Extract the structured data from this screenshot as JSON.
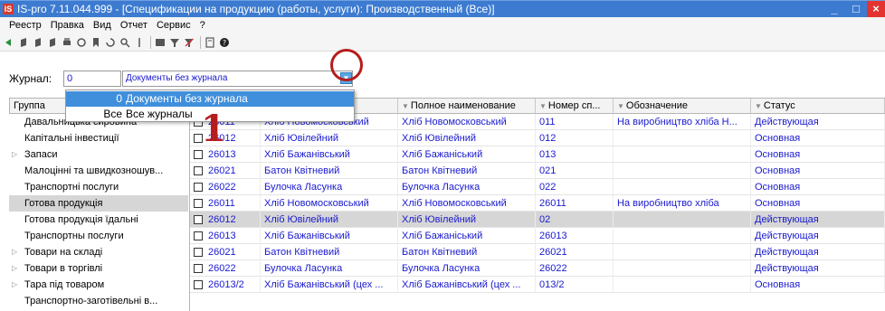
{
  "window": {
    "icon_label": "IS",
    "title": "IS-pro 7.11.044.999 - [Спецификации на продукцию (работы, услуги): Производственный (Все)]",
    "minimize": "_",
    "maximize": "□",
    "close": "×"
  },
  "menu": [
    "Реестр",
    "Правка",
    "Вид",
    "Отчет",
    "Сервис",
    "?"
  ],
  "toolbar_icons": [
    "new-icon",
    "copy-icon",
    "edit-icon",
    "delete-icon",
    "print-icon",
    "filter-icon",
    "refresh-icon",
    "find-icon",
    "bookmark-icon",
    "table-icon",
    "funnel-icon",
    "clear-filter-icon",
    "form-icon",
    "help-icon"
  ],
  "journal": {
    "label": "Журнал:",
    "code": "0",
    "name": "Документы без журнала",
    "dropdown_options": [
      {
        "code": "0",
        "name": "Документы без журнала"
      },
      {
        "code": "Все",
        "name": "Все журналы"
      }
    ]
  },
  "groups": {
    "header": "Группа",
    "items": [
      {
        "label": "Давальницька сировина",
        "expandable": false
      },
      {
        "label": "Капітальні інвестиції",
        "expandable": false
      },
      {
        "label": "Запаси",
        "expandable": true
      },
      {
        "label": "Малоцінні та швидкозношув...",
        "expandable": false
      },
      {
        "label": "Транспортні послуги",
        "expandable": false
      },
      {
        "label": "Готова продукція",
        "expandable": false
      },
      {
        "label": "Готова продукція їдальні",
        "expandable": false
      },
      {
        "label": "Транспортны послуги",
        "expandable": false
      },
      {
        "label": "Товари на складі",
        "expandable": true
      },
      {
        "label": "Товари в торгівлі",
        "expandable": true
      },
      {
        "label": "Тара під товаром",
        "expandable": true
      },
      {
        "label": "Транспортно-заготівельні в...",
        "expandable": false
      }
    ],
    "selected_index": 5
  },
  "table": {
    "columns": [
      "",
      "",
      "Полное наименование",
      "Номер сп...",
      "Обозначение",
      "Статус"
    ],
    "rows": [
      {
        "code": "26011",
        "name": "Хліб Новомосковський",
        "full": "Хліб Новомосковський",
        "number": "011",
        "designation": "На виробництво хліба Н...",
        "status": "Действующая"
      },
      {
        "code": "26012",
        "name": "Хліб Ювілейний",
        "full": "Хліб Ювілейний",
        "number": "012",
        "designation": "",
        "status": "Основная"
      },
      {
        "code": "26013",
        "name": "Хліб Бажанівський",
        "full": "Хліб Бажаніський",
        "number": "013",
        "designation": "",
        "status": "Основная"
      },
      {
        "code": "26021",
        "name": "Батон Квітневий",
        "full": "Батон Квітневий",
        "number": "021",
        "designation": "",
        "status": "Основная"
      },
      {
        "code": "26022",
        "name": "Булочка Ласунка",
        "full": "Булочка Ласунка",
        "number": "022",
        "designation": "",
        "status": "Основная"
      },
      {
        "code": "26011",
        "name": "Хліб Новомосковський",
        "full": "Хліб Новомосковський",
        "number": "26011",
        "designation": "На виробництво хліба",
        "status": "Основная"
      },
      {
        "code": "26012",
        "name": "Хліб Ювілейний",
        "full": "Хліб Ювілейний",
        "number": "02",
        "designation": "",
        "status": "Действующая"
      },
      {
        "code": "26013",
        "name": "Хліб Бажанівський",
        "full": "Хліб Бажаніський",
        "number": "26013",
        "designation": "",
        "status": "Действующая"
      },
      {
        "code": "26021",
        "name": "Батон Квітневий",
        "full": "Батон Квітневий",
        "number": "26021",
        "designation": "",
        "status": "Действующая"
      },
      {
        "code": "26022",
        "name": "Булочка Ласунка",
        "full": "Булочка Ласунка",
        "number": "26022",
        "designation": "",
        "status": "Действующая"
      },
      {
        "code": "26013/2",
        "name": "Хліб Бажанівський (цех ...",
        "full": "Хліб Бажанівський (цех ...",
        "number": "013/2",
        "designation": "",
        "status": "Основная"
      }
    ],
    "selected_index": 6
  },
  "annotation": {
    "number": "1"
  },
  "colors": {
    "titlebar": "#3c7bd0",
    "link_text": "#1a1ad0",
    "selection": "#d6d6d6",
    "dropdown_highlight": "#3f8fdc",
    "annotation_red": "#b71c1c"
  }
}
